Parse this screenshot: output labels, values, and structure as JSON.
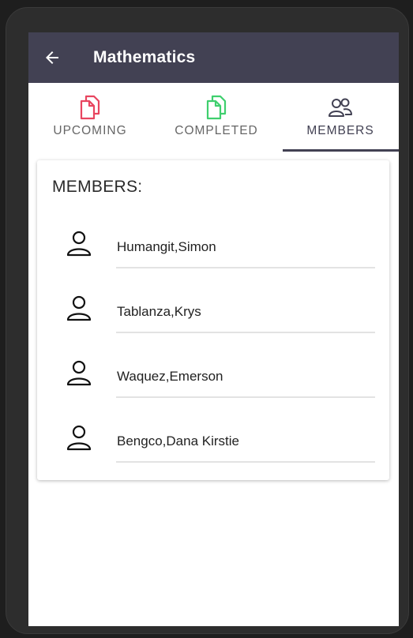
{
  "app_bar": {
    "title": "Mathematics",
    "back_icon": "arrow-left-icon",
    "background_color": "#424153"
  },
  "tabs": [
    {
      "label": "UPCOMING",
      "icon": "files-icon",
      "icon_color": "#e8455f",
      "active": false
    },
    {
      "label": "COMPLETED",
      "icon": "files-icon",
      "icon_color": "#3fcf6e",
      "active": false
    },
    {
      "label": "MEMBERS",
      "icon": "users-icon",
      "icon_color": "#424153",
      "active": true
    }
  ],
  "members_card": {
    "heading": "MEMBERS:",
    "members": [
      {
        "name": "Humangit,Simon",
        "icon": "person-icon"
      },
      {
        "name": "Tablanza,Krys",
        "icon": "person-icon"
      },
      {
        "name": "Waquez,Emerson",
        "icon": "person-icon"
      },
      {
        "name": "Bengco,Dana Kirstie",
        "icon": "person-icon"
      }
    ]
  }
}
